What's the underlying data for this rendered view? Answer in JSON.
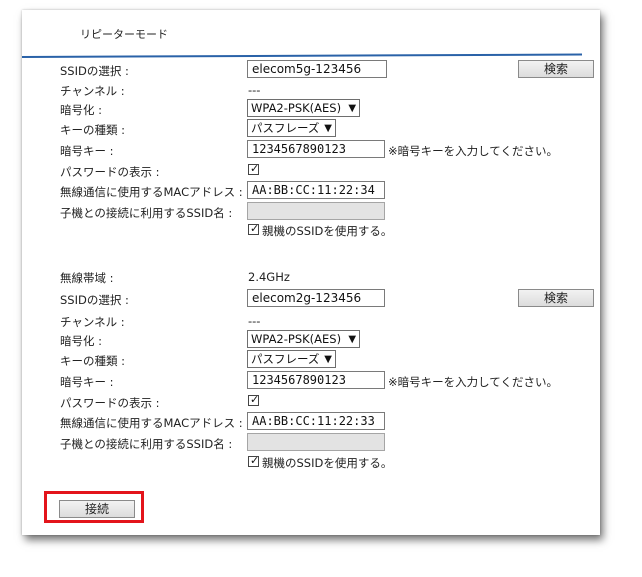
{
  "header": {
    "title": "リピーターモード"
  },
  "band5": {
    "ssid_label": "SSIDの選択 :",
    "ssid_value": "elecom5g-123456",
    "search_label": "検索",
    "channel_label": "チャンネル :",
    "channel_value": "---",
    "encryption_label": "暗号化 :",
    "encryption_value": "WPA2-PSK(AES)",
    "keytype_label": "キーの種類 :",
    "keytype_value": "パスフレーズ",
    "key_label": "暗号キー :",
    "key_value": "1234567890123",
    "key_note": "※暗号キーを入力してください。",
    "showpw_label": "パスワードの表示 :",
    "mac_label": "無線通信に使用するMACアドレス :",
    "mac_value": "AA:BB:CC:11:22:34",
    "child_ssid_label": "子機との接続に利用するSSID名 :",
    "child_ssid_value": "",
    "use_parent_label": "親機のSSIDを使用する。"
  },
  "band24": {
    "band_label": "無線帯域 :",
    "band_value": "2.4GHz",
    "ssid_label": "SSIDの選択 :",
    "ssid_value": "elecom2g-123456",
    "search_label": "検索",
    "channel_label": "チャンネル :",
    "channel_value": "---",
    "encryption_label": "暗号化 :",
    "encryption_value": "WPA2-PSK(AES)",
    "keytype_label": "キーの種類 :",
    "keytype_value": "パスフレーズ",
    "key_label": "暗号キー :",
    "key_value": "1234567890123",
    "key_note": "※暗号キーを入力してください。",
    "showpw_label": "パスワードの表示 :",
    "mac_label": "無線通信に使用するMACアドレス :",
    "mac_value": "AA:BB:CC:11:22:33",
    "child_ssid_label": "子機との接続に利用するSSID名 :",
    "child_ssid_value": "",
    "use_parent_label": "親機のSSIDを使用する。"
  },
  "footer": {
    "connect_label": "接続"
  },
  "colors": {
    "accent_line": "#2a62a8",
    "highlight_frame": "#e3141b"
  },
  "icons": {
    "select_arrow": "chevron-down-icon",
    "checkmark": "check-icon"
  }
}
